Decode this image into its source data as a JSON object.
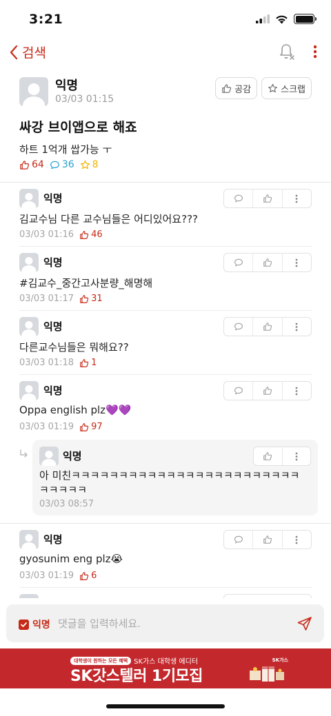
{
  "status_bar": {
    "time": "3:21"
  },
  "nav": {
    "back_label": "검색"
  },
  "post": {
    "author": "익명",
    "time": "03/03 01:15",
    "empathize_label": "공감",
    "scrap_label": "스크랩",
    "title": "싸강 브이앱으로 해죠",
    "body": "하트 1억개 쌉가능 ㅜ",
    "likes": "64",
    "comments": "36",
    "scraps": "8"
  },
  "comments": [
    {
      "author": "익명",
      "text": "김교수님 다른 교수님들은 어디있어요???",
      "time": "03/03 01:16",
      "likes": "46"
    },
    {
      "author": "익명",
      "text": "#김교수_중간고사분량_해명해",
      "time": "03/03 01:17",
      "likes": "31"
    },
    {
      "author": "익명",
      "text": "다른교수님들은 뭐해요??",
      "time": "03/03 01:18",
      "likes": "1"
    },
    {
      "author": "익명",
      "text": "Oppa english plz💜💜",
      "time": "03/03 01:19",
      "likes": "97"
    },
    {
      "author": "익명",
      "text": "gyosunim eng plz😭",
      "time": "03/03 01:19",
      "likes": "6"
    }
  ],
  "reply": {
    "author": "익명",
    "text": "아 미친ㅋㅋㅋㅋㅋㅋㅋㅋㅋㅋㅋㅋㅋㅋㅋㅋㅋㅋㅋㅋㅋㅋㅋㅋㅋㅋㅋㅋㅋ",
    "time": "03/03 08:57"
  },
  "composer": {
    "anonymous_label": "익명",
    "placeholder": "댓글을 입력하세요."
  },
  "banner": {
    "pill": "대학생이 원하는 모든 혜택",
    "subtitle": "SK가스 대학생 에디터",
    "headline": "SK갓스텔러 1기모집",
    "logo": "SK가스"
  },
  "colors": {
    "accent": "#c62917",
    "comment_count": "#27a2cf",
    "scrap_count": "#f2b600",
    "banner": "#c3282c"
  }
}
